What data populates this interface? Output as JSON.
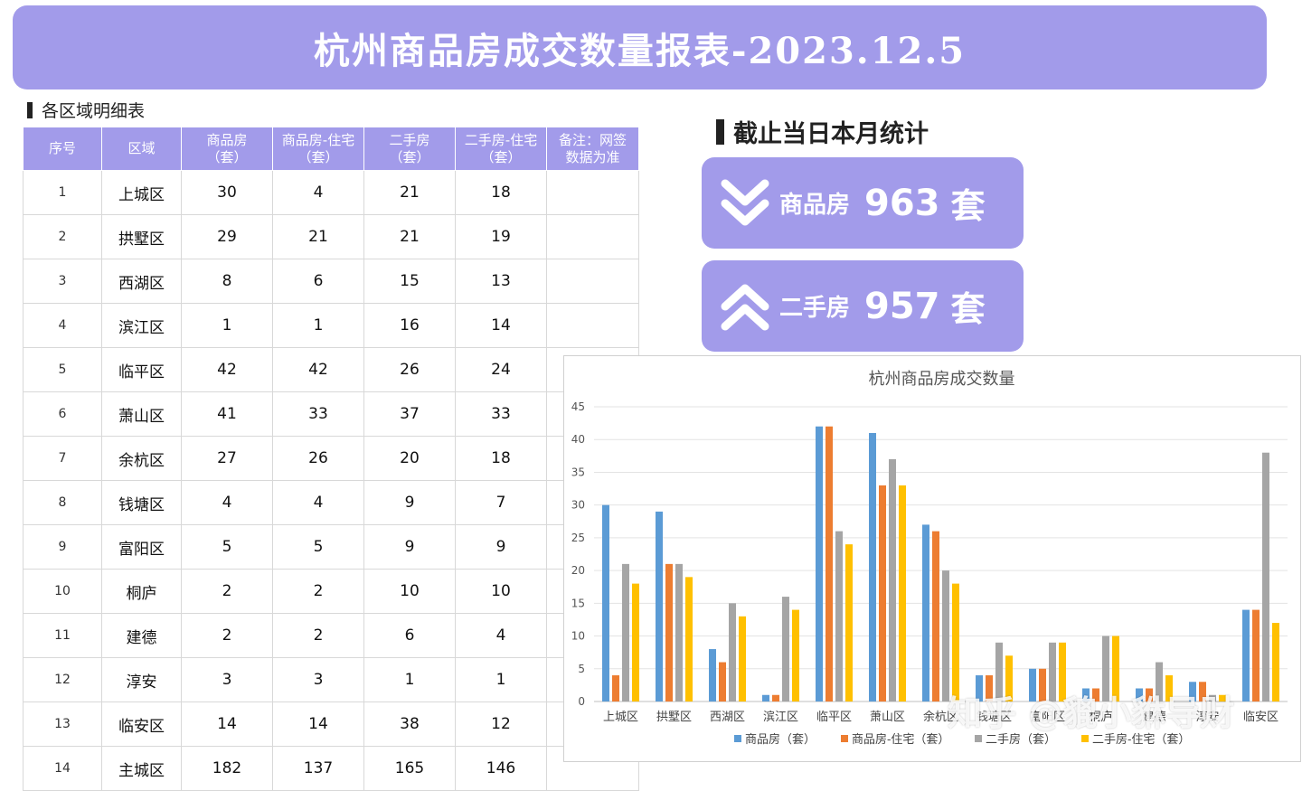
{
  "banner": {
    "title": "杭州商品房成交数量报表-2023.12.5"
  },
  "left_section": {
    "heading": "各区域明细表"
  },
  "right_section": {
    "heading": "截止当日本月统计"
  },
  "table": {
    "headers": [
      {
        "line1": "序号",
        "line2": ""
      },
      {
        "line1": "区域",
        "line2": ""
      },
      {
        "line1": "商品房",
        "line2": "（套）"
      },
      {
        "line1": "商品房-住宅",
        "line2": "（套）"
      },
      {
        "line1": "二手房",
        "line2": "（套）"
      },
      {
        "line1": "二手房-住宅",
        "line2": "（套）"
      },
      {
        "line1": "备注：网签",
        "line2": "数据为准"
      }
    ],
    "rows": [
      [
        "1",
        "上城区",
        "30",
        "4",
        "21",
        "18",
        ""
      ],
      [
        "2",
        "拱墅区",
        "29",
        "21",
        "21",
        "19",
        ""
      ],
      [
        "3",
        "西湖区",
        "8",
        "6",
        "15",
        "13",
        ""
      ],
      [
        "4",
        "滨江区",
        "1",
        "1",
        "16",
        "14",
        ""
      ],
      [
        "5",
        "临平区",
        "42",
        "42",
        "26",
        "24",
        ""
      ],
      [
        "6",
        "萧山区",
        "41",
        "33",
        "37",
        "33",
        ""
      ],
      [
        "7",
        "余杭区",
        "27",
        "26",
        "20",
        "18",
        ""
      ],
      [
        "8",
        "钱塘区",
        "4",
        "4",
        "9",
        "7",
        ""
      ],
      [
        "9",
        "富阳区",
        "5",
        "5",
        "9",
        "9",
        ""
      ],
      [
        "10",
        "桐庐",
        "2",
        "2",
        "10",
        "10",
        ""
      ],
      [
        "11",
        "建德",
        "2",
        "2",
        "6",
        "4",
        ""
      ],
      [
        "12",
        "淳安",
        "3",
        "3",
        "1",
        "1",
        ""
      ],
      [
        "13",
        "临安区",
        "14",
        "14",
        "38",
        "12",
        ""
      ],
      [
        "14",
        "主城区",
        "182",
        "137",
        "165",
        "146",
        ""
      ]
    ]
  },
  "stats": [
    {
      "icon": "double-chevron-down-icon",
      "label": "商品房",
      "value": "963",
      "unit": "套"
    },
    {
      "icon": "double-chevron-up-icon",
      "label": "二手房",
      "value": "957",
      "unit": "套"
    }
  ],
  "watermark": "知乎 @貔小貅导财",
  "chart_data": {
    "type": "bar",
    "title": "杭州商品房成交数量",
    "categories": [
      "上城区",
      "拱墅区",
      "西湖区",
      "滨江区",
      "临平区",
      "萧山区",
      "余杭区",
      "钱塘区",
      "富阳区",
      "桐庐",
      "建德",
      "淳安",
      "临安区"
    ],
    "series": [
      {
        "name": "商品房（套）",
        "color": "#5b9bd5",
        "values": [
          30,
          29,
          8,
          1,
          42,
          41,
          27,
          4,
          5,
          2,
          2,
          3,
          14
        ]
      },
      {
        "name": "商品房-住宅（套）",
        "color": "#ed7d31",
        "values": [
          4,
          21,
          6,
          1,
          42,
          33,
          26,
          4,
          5,
          2,
          2,
          3,
          14
        ]
      },
      {
        "name": "二手房（套）",
        "color": "#a5a5a5",
        "values": [
          21,
          21,
          15,
          16,
          26,
          37,
          20,
          9,
          9,
          10,
          6,
          1,
          38
        ]
      },
      {
        "name": "二手房-住宅（套）",
        "color": "#ffc000",
        "values": [
          18,
          19,
          13,
          14,
          24,
          33,
          18,
          7,
          9,
          10,
          4,
          1,
          12
        ]
      }
    ],
    "yticks": [
      0,
      5,
      10,
      15,
      20,
      25,
      30,
      35,
      40,
      45
    ],
    "ylim": [
      0,
      45
    ],
    "grid": true,
    "legend": "bottom"
  }
}
